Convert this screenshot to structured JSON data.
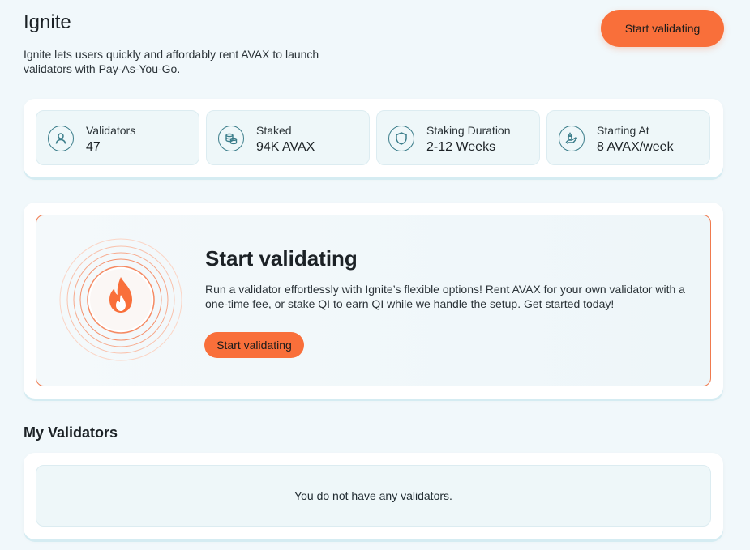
{
  "header": {
    "title": "Ignite",
    "description": "Ignite lets users quickly and affordably rent AVAX to launch validators with Pay-As-You-Go.",
    "cta_label": "Start validating"
  },
  "stats": [
    {
      "label": "Validators",
      "value": "47",
      "icon": "user-icon"
    },
    {
      "label": "Staked",
      "value": "94K AVAX",
      "icon": "coins-icon"
    },
    {
      "label": "Staking Duration",
      "value": "2-12 Weeks",
      "icon": "shield-icon"
    },
    {
      "label": "Starting At",
      "value": "8 AVAX/week",
      "icon": "hand-coin-icon"
    }
  ],
  "promo": {
    "title": "Start validating",
    "text": "Run a validator effortlessly with Ignite’s flexible options! Rent AVAX for your own validator with a one-time fee, or stake QI to earn QI while we handle the setup. Get started today!",
    "button_label": "Start validating",
    "icon": "flame-icon"
  },
  "my_validators": {
    "title": "My Validators",
    "empty_message": "You do not have any validators."
  },
  "colors": {
    "accent": "#f96f3a",
    "background": "#f1f8fb",
    "icon_stroke": "#3b7d8a"
  }
}
